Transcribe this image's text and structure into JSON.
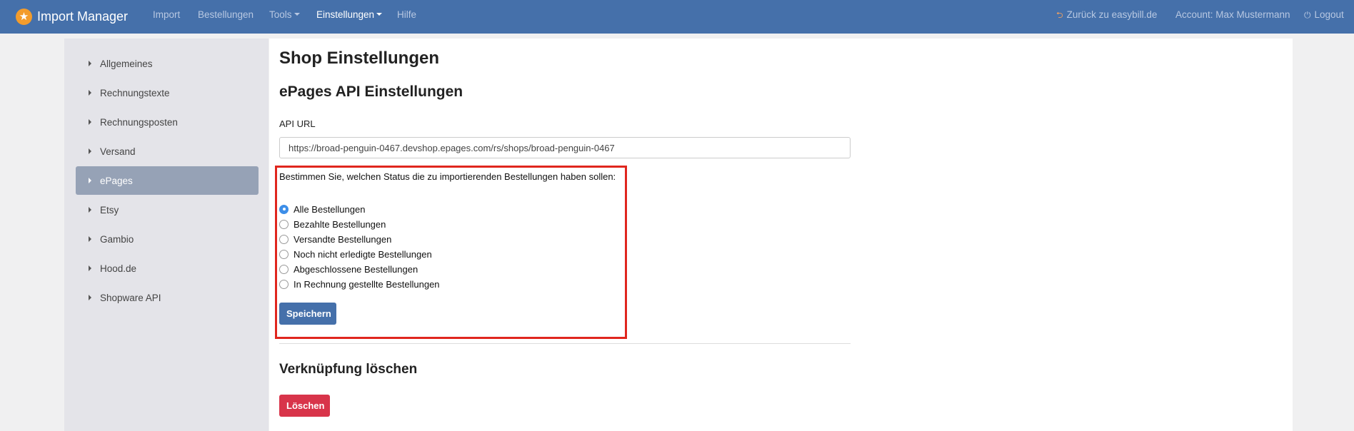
{
  "navbar": {
    "brand": "Import Manager",
    "items": [
      {
        "label": "Import"
      },
      {
        "label": "Bestellungen"
      },
      {
        "label": "Tools"
      },
      {
        "label": "Einstellungen"
      },
      {
        "label": "Hilfe"
      }
    ],
    "back_link": "Zurück zu easybill.de",
    "account": "Account: Max Mustermann",
    "logout": "Logout"
  },
  "sidebar": {
    "items": [
      {
        "label": "Allgemeines"
      },
      {
        "label": "Rechnungstexte"
      },
      {
        "label": "Rechnungsposten"
      },
      {
        "label": "Versand"
      },
      {
        "label": "ePages",
        "active": true
      },
      {
        "label": "Etsy"
      },
      {
        "label": "Gambio"
      },
      {
        "label": "Hood.de"
      },
      {
        "label": "Shopware API"
      }
    ]
  },
  "main": {
    "title": "Shop Einstellungen",
    "subtitle": "ePages API Einstellungen",
    "api_url_label": "API URL",
    "api_url_value": "https://broad-penguin-0467.devshop.epages.com/rs/shops/broad-penguin-0467",
    "status_question": "Bestimmen Sie, welchen Status die zu importierenden Bestellungen haben sollen:",
    "status_options": [
      {
        "label": "Alle Bestellungen",
        "checked": true
      },
      {
        "label": "Bezahlte Bestellungen",
        "checked": false
      },
      {
        "label": "Versandte Bestellungen",
        "checked": false
      },
      {
        "label": "Noch nicht erledigte Bestellungen",
        "checked": false
      },
      {
        "label": "Abgeschlossene Bestellungen",
        "checked": false
      },
      {
        "label": "In Rechnung gestellte Bestellungen",
        "checked": false
      }
    ],
    "save_label": "Speichern",
    "delete_section_title": "Verknüpfung löschen",
    "delete_label": "Löschen"
  },
  "colors": {
    "navbar": "#4570aa",
    "brand_logo": "#f39c2c",
    "highlight_border": "#e0261e",
    "save_button": "#4570aa",
    "delete_button": "#d8344a",
    "sidebar_active": "#96a2b6"
  },
  "icons": {
    "brand": "star-icon",
    "back_link": "back-arrow-icon",
    "logout": "power-icon"
  }
}
